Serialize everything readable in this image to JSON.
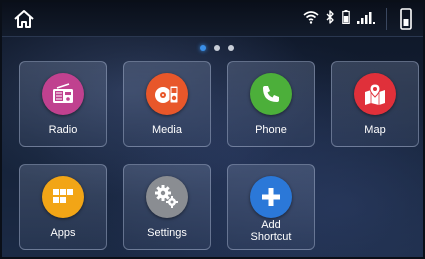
{
  "status_bar": {
    "home_icon": "home-icon",
    "wifi_icon": "wifi-icon",
    "bluetooth_icon": "bluetooth-icon",
    "battery_icon": "battery-icon",
    "signal_icon": "signal-icon",
    "phone_icon": "phone-device-icon"
  },
  "pager": {
    "pages": 3,
    "active_page": 1
  },
  "tiles": [
    {
      "label": "Radio",
      "icon": "radio-icon",
      "color": "#c0418f"
    },
    {
      "label": "Media",
      "icon": "media-icon",
      "color": "#e8572a"
    },
    {
      "label": "Phone",
      "icon": "phone-icon",
      "color": "#4caf3a"
    },
    {
      "label": "Map",
      "icon": "map-icon",
      "color": "#e0303a"
    },
    {
      "label": "Apps",
      "icon": "apps-icon",
      "color": "#f2a516"
    },
    {
      "label": "Settings",
      "icon": "gears-icon",
      "color": "#8a8d92"
    },
    {
      "label": "Add\nShortcut",
      "icon": "plus-icon",
      "color": "#2b78d8"
    }
  ]
}
